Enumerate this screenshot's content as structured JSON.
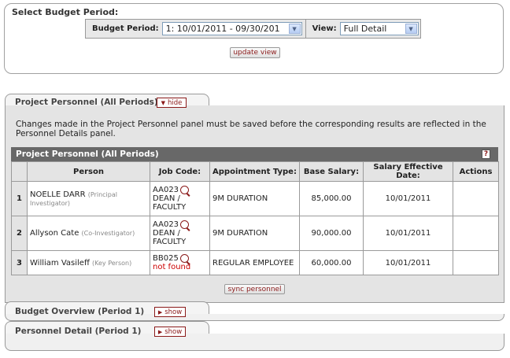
{
  "budget_period_box": {
    "title": "Select Budget Period:",
    "period_label": "Budget Period:",
    "period_value": "1:  10/01/2011 - 09/30/201",
    "view_label": "View:",
    "view_value": "Full Detail",
    "update_label": "update view"
  },
  "project_personnel_tab": {
    "label": "Project Personnel (All Periods)",
    "toggle_label": "hide",
    "note": "Changes made in the Project Personnel panel must be saved before the corresponding results are reflected in the Personnel Details panel.",
    "grid_title": "Project Personnel (All Periods)",
    "help_label": "?",
    "columns": [
      "Person",
      "Job Code:",
      "Appointment Type:",
      "Base Salary:",
      "Salary Effective Date:",
      "Actions"
    ],
    "rows": [
      {
        "num": "1",
        "name": "NOELLE DARR",
        "role": "(Principal Investigator)",
        "job_code": "AA023",
        "job_desc": "DEAN / FACULTY",
        "appt_type": "9M DURATION",
        "base_salary": "85,000.00",
        "effective_date": "10/01/2011"
      },
      {
        "num": "2",
        "name": "Allyson Cate",
        "role": "(Co-Investigator)",
        "job_code": "AA023",
        "job_desc": "DEAN / FACULTY",
        "appt_type": "9M DURATION",
        "base_salary": "90,000.00",
        "effective_date": "10/01/2011"
      },
      {
        "num": "3",
        "name": "William Vasileff",
        "role": "(Key Person)",
        "job_code": "BB025",
        "job_desc": "not found",
        "appt_type": "REGULAR EMPLOYEE",
        "base_salary": "60,000.00",
        "effective_date": "10/01/2011"
      }
    ],
    "sync_label": "sync personnel"
  },
  "budget_overview_tab": {
    "label": "Budget Overview (Period 1)",
    "toggle_label": "show"
  },
  "personnel_detail_tab": {
    "label": "Personnel Detail (Period 1)",
    "toggle_label": "show"
  },
  "colors": {
    "accent": "#8b1a1a",
    "grid_header": "#686868",
    "panel_bg": "#e4e4e4",
    "error": "#cc0000"
  },
  "icons": {
    "lookup": "magnifier-icon",
    "dropdown": "chevron-down-icon",
    "toggle": "triangle-right-icon",
    "help": "help-icon"
  }
}
